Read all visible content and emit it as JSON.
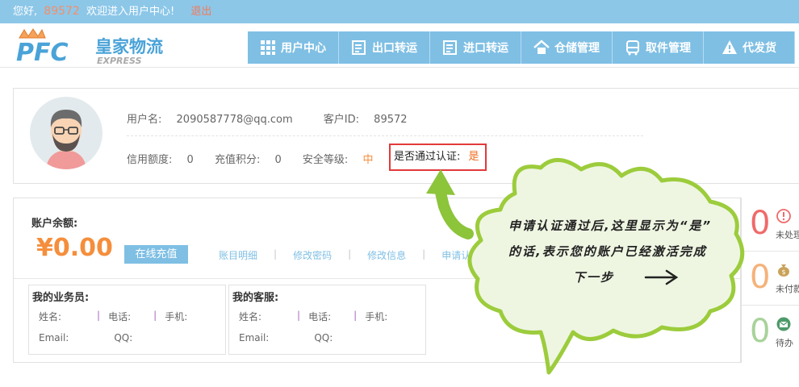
{
  "topbar": {
    "greeting": "您好,",
    "user_id": "89572",
    "welcome": "欢迎进入用户中心!",
    "logout": "退出"
  },
  "brand": {
    "logo_mark": "PFC",
    "name": "皇家物流",
    "sub": "EXPRESS"
  },
  "nav": [
    {
      "label": "用户中心",
      "icon": "grid-icon"
    },
    {
      "label": "出口转运",
      "icon": "export-doc-icon"
    },
    {
      "label": "进口转运",
      "icon": "import-doc-icon"
    },
    {
      "label": "仓储管理",
      "icon": "house-icon"
    },
    {
      "label": "取件管理",
      "icon": "bus-icon"
    },
    {
      "label": "代发货",
      "icon": "warning-icon"
    }
  ],
  "profile": {
    "username_label": "用户名:",
    "username": "2090587778@qq.com",
    "customer_id_label": "客户ID:",
    "customer_id": "89572",
    "credit_label": "信用额度:",
    "credit": "0",
    "points_label": "充值积分:",
    "points": "0",
    "security_label": "安全等级:",
    "security": "中",
    "verified_label": "是否通过认证:",
    "verified": "是"
  },
  "account": {
    "balance_label": "账户余额:",
    "balance": "¥0.00",
    "recharge": "在线充值",
    "links": [
      "账目明细",
      "修改密码",
      "修改信息",
      "申请认证"
    ]
  },
  "sales": {
    "title": "我的业务员:",
    "name": "姓名:",
    "phone": "电话:",
    "mobile": "手机:",
    "email": "Email:",
    "qq": "QQ:"
  },
  "service": {
    "title": "我的客服:",
    "name": "姓名:",
    "phone": "电话:",
    "mobile": "手机:",
    "email": "Email:",
    "qq": "QQ:"
  },
  "side": [
    {
      "num": "0",
      "label": "未处理",
      "color": "#f06a6a",
      "icon": "info-icon"
    },
    {
      "num": "0",
      "label": "未付款",
      "color": "#f5b27a",
      "icon": "money-bag-icon"
    },
    {
      "num": "0",
      "label": "待办",
      "color": "#a8d29a",
      "icon": "mail-icon"
    }
  ],
  "callout": {
    "line1": "申请认证通过后,这里显示为“是”",
    "line2": "的话,表示您的账户已经激活完成",
    "line3": "下一步"
  },
  "colors": {
    "accent": "#7fbfe4",
    "orange": "#f58e3c",
    "highlight": "#e23a3a",
    "callout_border": "#9ccc3c",
    "callout_fill": "#eef6e2"
  }
}
